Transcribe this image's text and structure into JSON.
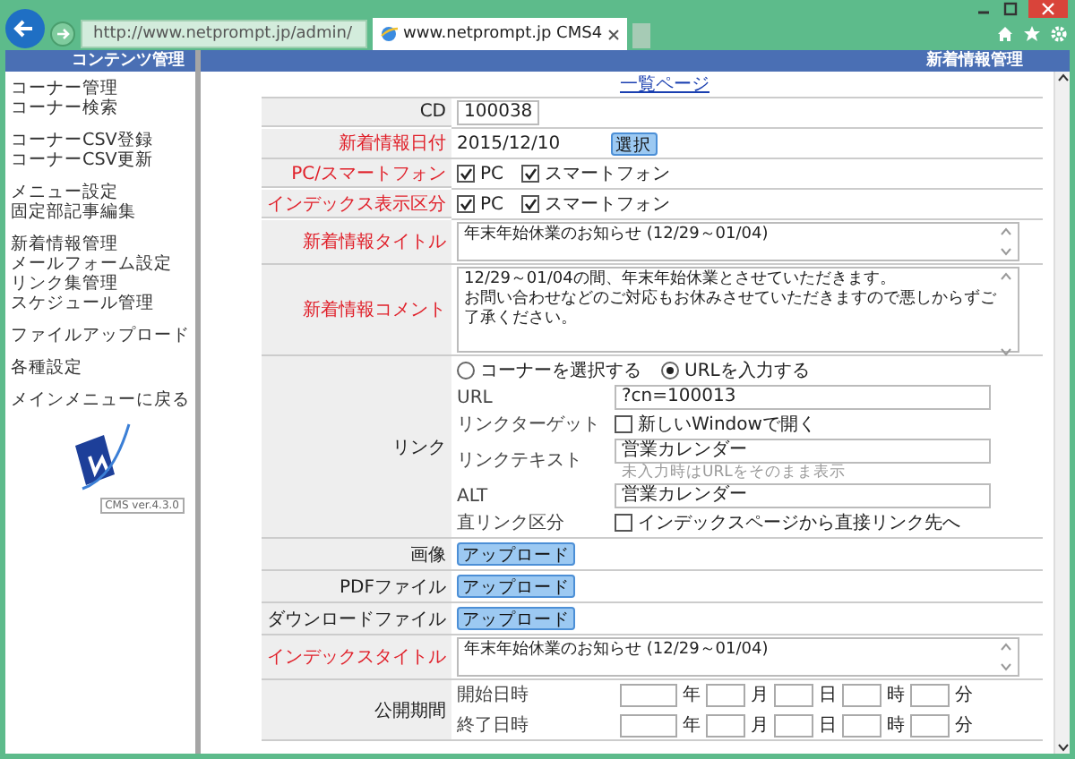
{
  "browser": {
    "address": "http://www.netprompt.jp/admin/",
    "tab_title": "www.netprompt.jp  CMS4"
  },
  "sidebar": {
    "title": "コンテンツ管理",
    "groups": [
      {
        "items": [
          "コーナー管理",
          "コーナー検索"
        ]
      },
      {
        "items": [
          "コーナーCSV登録",
          "コーナーCSV更新"
        ]
      },
      {
        "items": [
          "メニュー設定",
          "固定部記事編集"
        ]
      },
      {
        "items": [
          "新着情報管理",
          "メールフォーム設定",
          "リンク集管理",
          "スケジュール管理"
        ]
      },
      {
        "items": [
          "ファイルアップロード"
        ]
      },
      {
        "items": [
          "各種設定"
        ]
      },
      {
        "items": [
          "メインメニューに戻る"
        ]
      }
    ],
    "version": "CMS ver.4.3.0"
  },
  "header": {
    "title": "新着情報管理"
  },
  "list_link": "一覧ページ",
  "form": [
    {
      "kind": "code",
      "label": "CD",
      "required": false,
      "value": "100038"
    },
    {
      "kind": "date",
      "label": "新着情報日付",
      "required": true,
      "value": "2015/12/10",
      "button": "選択"
    },
    {
      "kind": "checks",
      "label": "PC/スマートフォン",
      "required": true,
      "options": [
        {
          "label": "PC",
          "checked": true
        },
        {
          "label": "スマートフォン",
          "checked": true
        }
      ]
    },
    {
      "kind": "checks",
      "label": "インデックス表示区分",
      "required": true,
      "options": [
        {
          "label": "PC",
          "checked": true
        },
        {
          "label": "スマートフォン",
          "checked": true
        }
      ]
    },
    {
      "kind": "textbox",
      "label": "新着情報タイトル",
      "required": true,
      "value": "年末年始休業のお知らせ (12/29～01/04)"
    },
    {
      "kind": "textarea",
      "label": "新着情報コメント",
      "required": true,
      "lines": [
        "12/29～01/04の間、年末年始休業とさせていただきます。",
        "お問い合わせなどのご対応もお休みさせていただきますので悪しからずご了承ください。"
      ]
    },
    {
      "kind": "link",
      "label": "リンク",
      "required": false,
      "radios": [
        {
          "label": "コーナーを選択する",
          "selected": false
        },
        {
          "label": "URLを入力する",
          "selected": true
        }
      ],
      "fields": [
        {
          "kind": "input",
          "label": "URL",
          "value": "?cn=100013"
        },
        {
          "kind": "check",
          "label": "リンクターゲット",
          "option": "新しいWindowで開く",
          "checked": false
        },
        {
          "kind": "input",
          "label": "リンクテキスト",
          "value": "営業カレンダー",
          "hint": "未入力時はURLをそのまま表示"
        },
        {
          "kind": "input",
          "label": "ALT",
          "value": "営業カレンダー"
        },
        {
          "kind": "check",
          "label": "直リンク区分",
          "option": "インデックスページから直接リンク先へ",
          "checked": false
        }
      ]
    },
    {
      "kind": "upload",
      "label": "画像",
      "required": false,
      "button": "アップロード"
    },
    {
      "kind": "upload",
      "label": "PDFファイル",
      "required": false,
      "button": "アップロード"
    },
    {
      "kind": "upload",
      "label": "ダウンロードファイル",
      "required": false,
      "button": "アップロード"
    },
    {
      "kind": "textbox",
      "label": "インデックスタイトル",
      "required": true,
      "value": "年末年始休業のお知らせ (12/29～01/04)"
    },
    {
      "kind": "period",
      "label": "公開期間",
      "required": false,
      "lines": [
        {
          "label": "開始日時",
          "units": [
            "年",
            "月",
            "日",
            "時",
            "分"
          ]
        },
        {
          "label": "終了日時",
          "units": [
            "年",
            "月",
            "日",
            "時",
            "分"
          ]
        }
      ]
    }
  ]
}
